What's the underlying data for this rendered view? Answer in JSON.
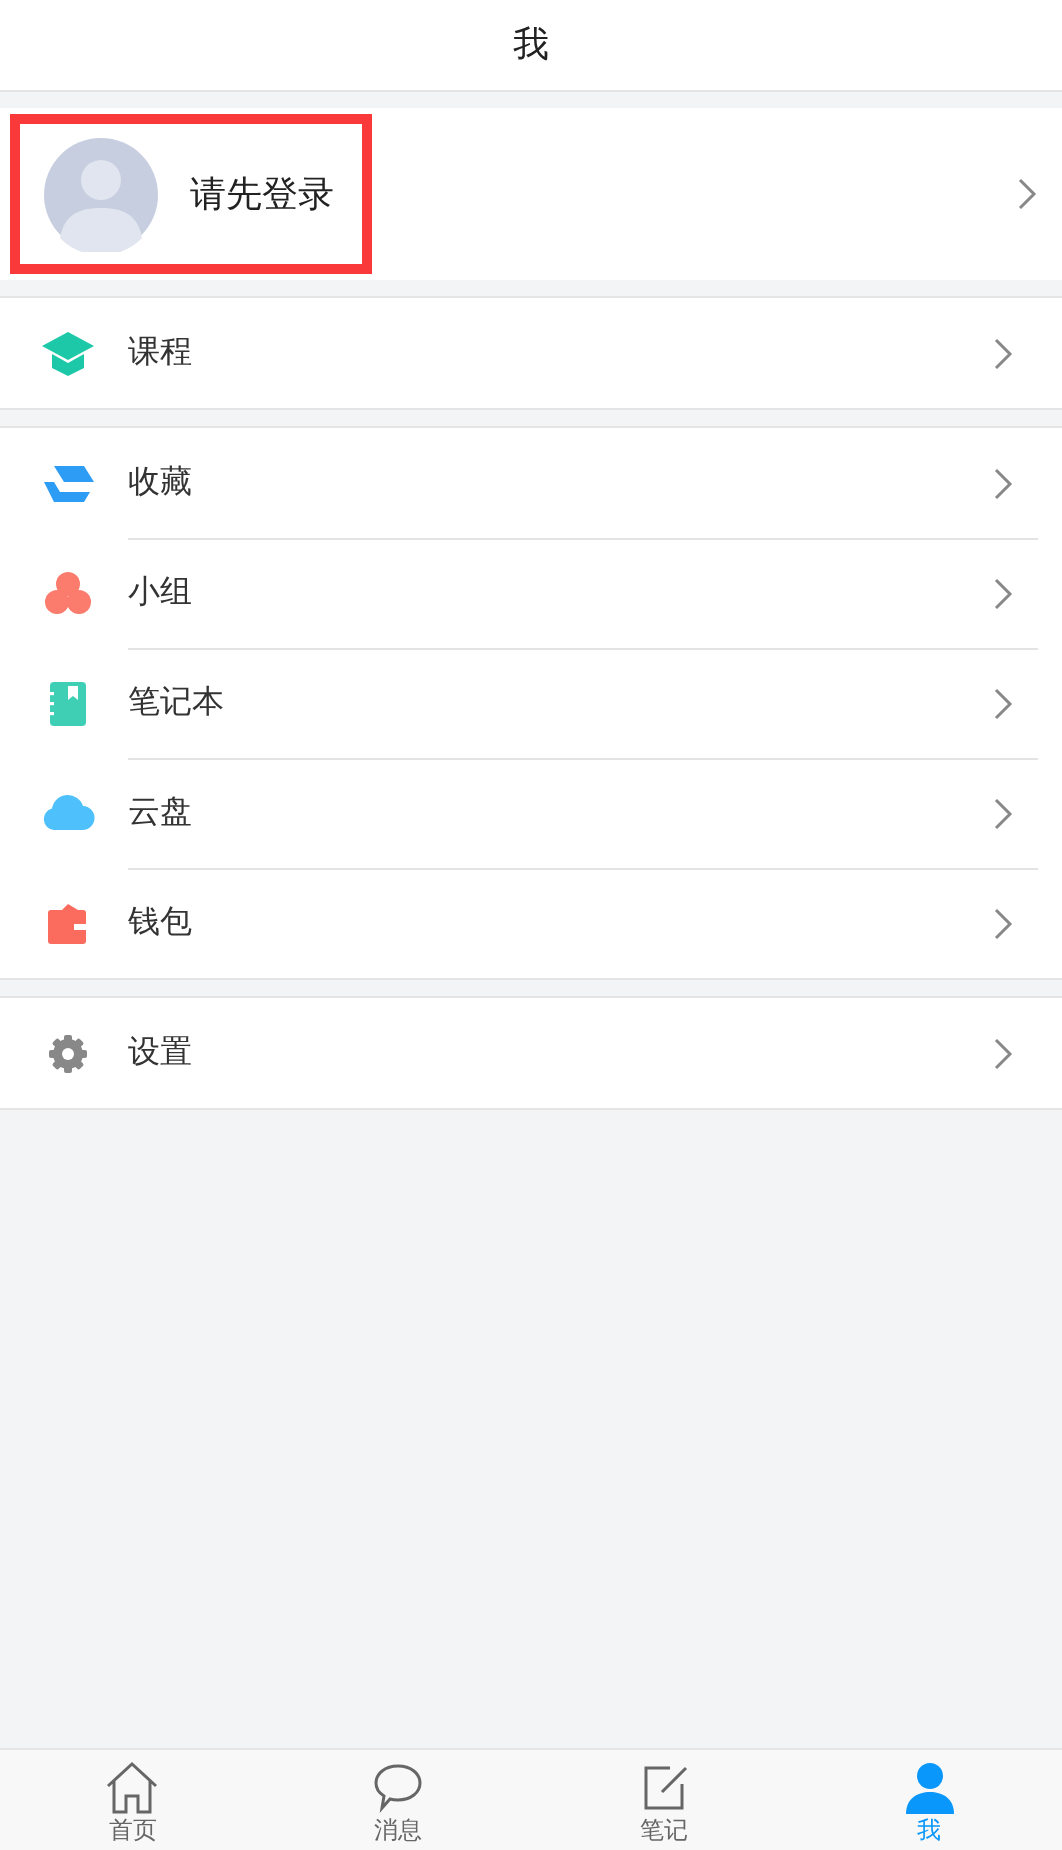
{
  "header": {
    "title": "我"
  },
  "login": {
    "label": "请先登录",
    "highlighted": true
  },
  "sections": [
    {
      "items": [
        {
          "kind": "course",
          "label": "课程"
        }
      ]
    },
    {
      "items": [
        {
          "kind": "favorites",
          "label": "收藏"
        },
        {
          "kind": "group",
          "label": "小组"
        },
        {
          "kind": "notebook",
          "label": "笔记本"
        },
        {
          "kind": "cloud",
          "label": "云盘"
        },
        {
          "kind": "wallet",
          "label": "钱包"
        }
      ]
    },
    {
      "items": [
        {
          "kind": "settings",
          "label": "设置"
        }
      ]
    }
  ],
  "tabs": [
    {
      "kind": "home",
      "label": "首页",
      "selected": false
    },
    {
      "kind": "messages",
      "label": "消息",
      "selected": false
    },
    {
      "kind": "notes",
      "label": "笔记",
      "selected": false
    },
    {
      "kind": "me",
      "label": "我",
      "selected": true
    }
  ]
}
